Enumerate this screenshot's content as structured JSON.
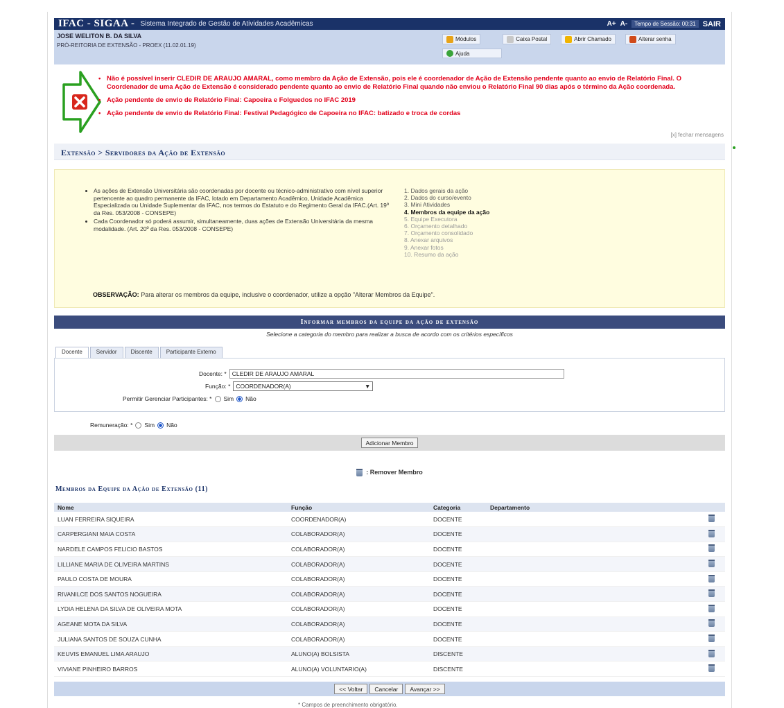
{
  "header": {
    "brand": "IFAC - SIGAA -",
    "system_name": "Sistema Integrado de Gestão de Atividades Acadêmicas",
    "font_plus": "A+",
    "font_minus": "A-",
    "session": "Tempo de Sessão: 00:31",
    "sair": "SAIR"
  },
  "user": {
    "name": "JOSE WELITON B. DA SILVA",
    "unit": "PRÓ-REITORIA DE EXTENSÃO - PROEX (11.02.01.19)",
    "links": [
      "Módulos",
      "Caixa Postal",
      "Abrir Chamado",
      "Alterar senha"
    ],
    "ajuda": "Ajuda"
  },
  "errors": {
    "items": [
      "Não é possível inserir CLEDIR DE ARAUJO AMARAL, como membro da Ação de Extensão, pois ele é coordenador de Ação de Extensão pendente quanto ao envio de Relatório Final. O Coordenador de uma Ação de Extensão é considerado pendente quanto ao envio de Relatório Final quando não enviou o Relatório Final 90 dias após o término da Ação coordenada.",
      "Ação pendente de envio de Relatório Final: Capoeira e Folguedos no IFAC 2019",
      "Ação pendente de envio de Relatório Final: Festival Pedagógico de Capoeira no IFAC: batizado e troca de cordas"
    ],
    "close": "[x] fechar mensagens"
  },
  "breadcrumb": "Extensão > Servidores da Ação de Extensão",
  "info": {
    "rules": [
      "As ações de Extensão Universitária são coordenadas por docente ou técnico-administrativo com nível superior pertencente ao quadro permanente da IFAC, lotado em Departamento Acadêmico, Unidade Acadêmica Especializada ou Unidade Suplementar da IFAC, nos termos do Estatuto e do Regimento Geral da IFAC.(Art. 19º da Res. 053/2008 - CONSEPE)",
      "Cada Coordenador só poderá assumir, simultaneamente, duas ações de Extensão Universitária da mesma modalidade. (Art. 20º da Res. 053/2008 - CONSEPE)"
    ],
    "steps": [
      "1. Dados gerais da ação",
      "2. Dados do curso/evento",
      "3. Mini Atividades",
      "4. Membros da equipe da ação",
      "5. Equipe Executora",
      "6. Orçamento detalhado",
      "7. Orçamento consolidado",
      "8. Anexar arquivos",
      "9. Anexar fotos",
      "10. Resumo da ação"
    ],
    "obs_label": "OBSERVAÇÃO:",
    "obs_text": " Para alterar os membros da equipe, inclusive o coordenador, utilize a opção \"Alterar Membros da Equipe\"."
  },
  "form": {
    "title": "Informar membros da equipe da ação de extensão",
    "subtitle": "Selecione a categoria do membro para realizar a busca de acordo com os critérios específicos",
    "tabs": [
      "Docente",
      "Servidor",
      "Discente",
      "Participante Externo"
    ],
    "docente_label": "Docente: *",
    "docente_value": "CLEDIR DE ARAUJO AMARAL",
    "funcao_label": "Função: *",
    "funcao_value": "COORDENADOR(A)",
    "gerenciar_label": "Permitir Gerenciar Participantes: *",
    "sim": "Sim",
    "nao": "Não",
    "remuneracao_label": "Remuneração: *",
    "add_button": "Adicionar Membro"
  },
  "remove_label": ": Remover Membro",
  "members": {
    "title": "Membros da Equipe da Ação de Extensão (11)",
    "columns": [
      "Nome",
      "Função",
      "Categoria",
      "Departamento"
    ],
    "rows": [
      {
        "nome": "LUAN FERREIRA SIQUEIRA",
        "funcao": "COORDENADOR(A)",
        "categoria": "DOCENTE"
      },
      {
        "nome": "CARPERGIANI MAIA COSTA",
        "funcao": "COLABORADOR(A)",
        "categoria": "DOCENTE"
      },
      {
        "nome": "NARDELE CAMPOS FELICIO BASTOS",
        "funcao": "COLABORADOR(A)",
        "categoria": "DOCENTE"
      },
      {
        "nome": "LILLIANE MARIA DE OLIVEIRA MARTINS",
        "funcao": "COLABORADOR(A)",
        "categoria": "DOCENTE"
      },
      {
        "nome": "PAULO COSTA DE MOURA",
        "funcao": "COLABORADOR(A)",
        "categoria": "DOCENTE"
      },
      {
        "nome": "RIVANILCE DOS SANTOS NOGUEIRA",
        "funcao": "COLABORADOR(A)",
        "categoria": "DOCENTE"
      },
      {
        "nome": "LYDIA HELENA DA SILVA DE OLIVEIRA MOTA",
        "funcao": "COLABORADOR(A)",
        "categoria": "DOCENTE"
      },
      {
        "nome": "AGEANE MOTA DA SILVA",
        "funcao": "COLABORADOR(A)",
        "categoria": "DOCENTE"
      },
      {
        "nome": "JULIANA SANTOS DE SOUZA CUNHA",
        "funcao": "COLABORADOR(A)",
        "categoria": "DOCENTE"
      },
      {
        "nome": "KEUVIS EMANUEL LIMA ARAUJO",
        "funcao": "ALUNO(A) BOLSISTA",
        "categoria": "DISCENTE"
      },
      {
        "nome": "VIVIANE PINHEIRO BARROS",
        "funcao": "ALUNO(A) VOLUNTARIO(A)",
        "categoria": "DISCENTE"
      }
    ]
  },
  "nav": {
    "back": "<< Voltar",
    "cancel": "Cancelar",
    "next": "Avançar >>"
  },
  "footer": "Campos de preenchimento obrigatório.",
  "colors": {
    "header": "#1a3268",
    "error": "#e2001a",
    "info_bg": "#fffde0",
    "arrow": "#2aa020"
  }
}
